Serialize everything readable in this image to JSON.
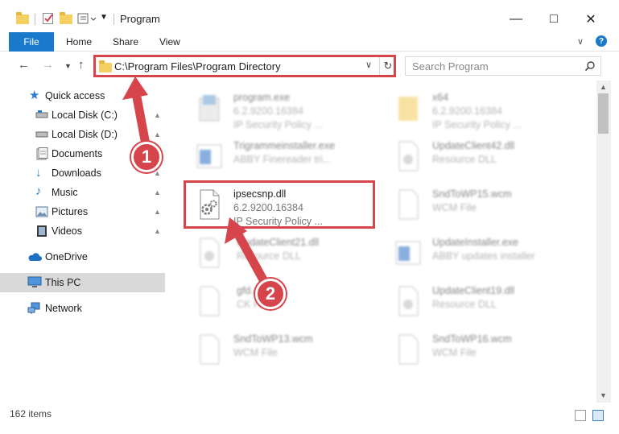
{
  "window": {
    "title": "Program"
  },
  "ribbon": {
    "file": "File",
    "tabs": [
      "Home",
      "Share",
      "View"
    ]
  },
  "address": {
    "path": "C:\\Program Files\\Program Directory"
  },
  "search": {
    "placeholder": "Search Program"
  },
  "sidebar": {
    "items": [
      {
        "label": "Quick access",
        "icon": "star-icon"
      },
      {
        "label": "Local Disk (C:)",
        "icon": "drive-icon"
      },
      {
        "label": "Local Disk (D:)",
        "icon": "drive-icon"
      },
      {
        "label": "Documents",
        "icon": "documents-icon"
      },
      {
        "label": "Downloads",
        "icon": "download-icon"
      },
      {
        "label": "Music",
        "icon": "music-icon"
      },
      {
        "label": "Pictures",
        "icon": "pictures-icon"
      },
      {
        "label": "Videos",
        "icon": "videos-icon"
      },
      {
        "label": "OneDrive",
        "icon": "cloud-icon"
      },
      {
        "label": "This PC",
        "icon": "computer-icon"
      },
      {
        "label": "Network",
        "icon": "network-icon"
      }
    ]
  },
  "files": [
    {
      "name": "program.exe",
      "line2": "6.2.9200.16384",
      "line3": "IP Security Policy ..."
    },
    {
      "name": "x64",
      "line2": "6.2.9200.16384",
      "line3": "IP Security Policy ..."
    },
    {
      "name": "Trigrammeinstaller.exe",
      "line2": "ABBY Finereader tri...",
      "line3": ""
    },
    {
      "name": "UpdateClient42.dll",
      "line2": "Resource DLL",
      "line3": ""
    },
    {
      "name": "ipsecsnp.dll",
      "line2": "6.2.9200.16384",
      "line3": "IP Security Policy ..."
    },
    {
      "name": "SndToWP15.wcm",
      "line2": "WCM File",
      "line3": ""
    },
    {
      "name": "UpdateClient21.dll",
      "line2": "Resource DLL",
      "line3": ""
    },
    {
      "name": "UpdateInstaller.exe",
      "line2": "ABBY updates installer",
      "line3": ""
    },
    {
      "name": "gfd.cfg",
      "line2": "CK File",
      "line3": ""
    },
    {
      "name": "UpdateClient19.dll",
      "line2": "Resource DLL",
      "line3": ""
    },
    {
      "name": "SndToWP13.wcm",
      "line2": "WCM File",
      "line3": ""
    },
    {
      "name": "SndToWP16.wcm",
      "line2": "WCM File",
      "line3": ""
    }
  ],
  "status": {
    "count": "162 items"
  },
  "callouts": [
    "1",
    "2"
  ],
  "colors": {
    "accent": "#1979ca",
    "annotation": "#d6444c"
  }
}
